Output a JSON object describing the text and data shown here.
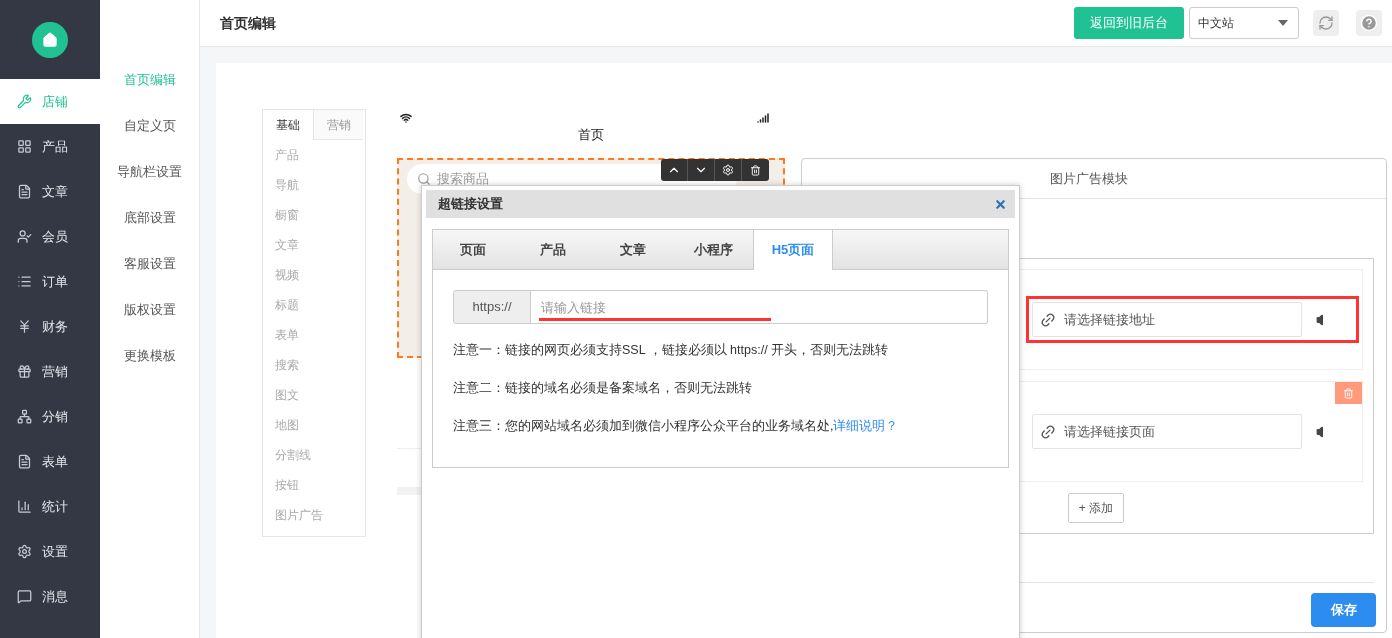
{
  "sidebar": {
    "items": [
      {
        "label": "店铺",
        "selected": true
      },
      {
        "label": "产品",
        "selected": false
      },
      {
        "label": "文章",
        "selected": false
      },
      {
        "label": "会员",
        "selected": false
      },
      {
        "label": "订单",
        "selected": false
      },
      {
        "label": "财务",
        "selected": false
      },
      {
        "label": "营销",
        "selected": false
      },
      {
        "label": "分销",
        "selected": false
      },
      {
        "label": "表单",
        "selected": false
      },
      {
        "label": "统计",
        "selected": false
      },
      {
        "label": "设置",
        "selected": false
      },
      {
        "label": "消息",
        "selected": false
      }
    ]
  },
  "subnav": {
    "items": [
      {
        "label": "首页编辑",
        "selected": true
      },
      {
        "label": "自定义页",
        "selected": false
      },
      {
        "label": "导航栏设置",
        "selected": false
      },
      {
        "label": "底部设置",
        "selected": false
      },
      {
        "label": "客服设置",
        "selected": false
      },
      {
        "label": "版权设置",
        "selected": false
      },
      {
        "label": "更换模板",
        "selected": false
      }
    ]
  },
  "header": {
    "title": "首页编辑",
    "back_button": "返回到旧后台",
    "site_select": {
      "value": "中文站"
    }
  },
  "palette": {
    "tabs": [
      {
        "label": "基础",
        "selected": true
      },
      {
        "label": "营销",
        "selected": false
      }
    ],
    "items": [
      "产品",
      "导航",
      "橱窗",
      "文章",
      "视频",
      "标题",
      "表单",
      "搜索",
      "图文",
      "地图",
      "分割线",
      "按钮",
      "图片广告"
    ]
  },
  "preview": {
    "title": "首页",
    "search": {
      "placeholder": "搜索商品"
    }
  },
  "settings_panel": {
    "title": "图片广告模块",
    "links": [
      {
        "placeholder": "请选择链接地址",
        "highlighted": true,
        "deletable": false
      },
      {
        "placeholder": "请选择链接页面",
        "highlighted": false,
        "deletable": true
      }
    ],
    "add_button": "+ 添加",
    "save_button": "保存"
  },
  "dialog": {
    "title": "超链接设置",
    "tabs": [
      {
        "label": "页面",
        "selected": false
      },
      {
        "label": "产品",
        "selected": false
      },
      {
        "label": "文章",
        "selected": false
      },
      {
        "label": "小程序",
        "selected": false
      },
      {
        "label": "H5页面",
        "selected": true
      }
    ],
    "url_prefix": "https://",
    "url_field": {
      "placeholder": "请输入链接"
    },
    "notes": [
      {
        "text": "注意一：链接的网页必须支持SSL ，链接必须以 https:// 开头，否则无法跳转"
      },
      {
        "text": "注意二：链接的域名必须是备案域名，否则无法跳转"
      },
      {
        "text": "注意三：您的网站域名必须加到微信小程序公众平台的业务域名处,",
        "link": "详细说明？"
      }
    ]
  }
}
